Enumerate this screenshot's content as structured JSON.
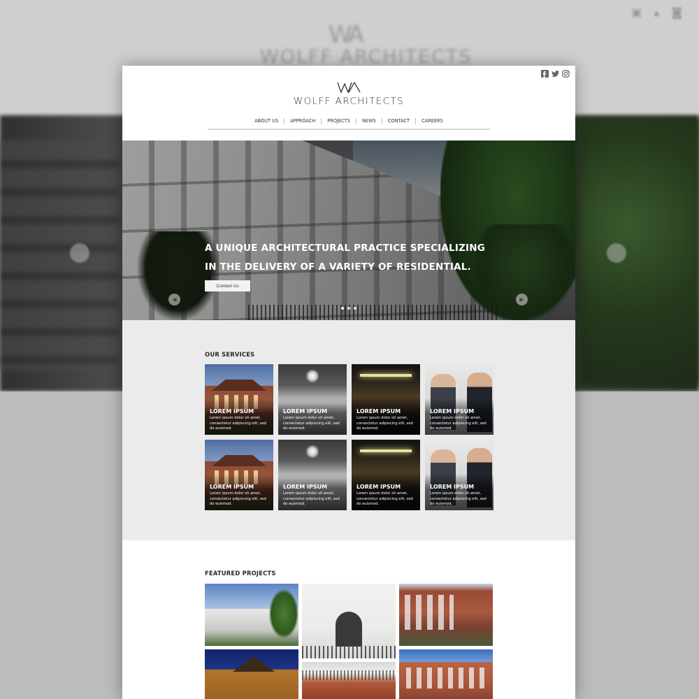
{
  "site": {
    "brand_mark": "WA",
    "brand_name": "WOLFF ARCHITECTS",
    "social": [
      {
        "icon": "facebook-icon"
      },
      {
        "icon": "twitter-icon"
      },
      {
        "icon": "instagram-icon"
      }
    ],
    "nav": [
      "ABOUT US",
      "APPROACH",
      "PROJECTS",
      "NEWS",
      "CONTACT",
      "CAREERS"
    ]
  },
  "hero": {
    "headline_line1": "A UNIQUE ARCHITECTURAL PRACTICE SPECIALIZING",
    "headline_line2": "IN THE DELIVERY OF A VARIETY OF RESIDENTIAL.",
    "cta_label": "Contact Us",
    "prev_icon": "chevron-left-icon",
    "next_icon": "chevron-right-icon",
    "slide_count": 3,
    "active_slide": 1
  },
  "services": {
    "title": "OUR SERVICES",
    "items": [
      {
        "title": "LOREM IPSUM",
        "desc": "Lorem ipsum dolor sit amet, consectetur adipiscing elit, sed do euismod."
      },
      {
        "title": "LOREM IPSUM",
        "desc": "Lorem ipsum dolor sit amet, consectetur adipiscing elit, sed do euismod."
      },
      {
        "title": "LOREM IPSUM",
        "desc": "Lorem ipsum dolor sit amet, consectetur adipiscing elit, sed do euismod."
      },
      {
        "title": "LOREM IPSUM",
        "desc": "Lorem ipsum dolor sit amet, consectetur adipiscing elit, sed do euismod."
      },
      {
        "title": "LOREM IPSUM",
        "desc": "Lorem ipsum dolor sit amet, consectetur adipiscing elit, sed do euismod."
      },
      {
        "title": "LOREM IPSUM",
        "desc": "Lorem ipsum dolor sit amet, consectetur adipiscing elit, sed do euismod."
      },
      {
        "title": "LOREM IPSUM",
        "desc": "Lorem ipsum dolor sit amet, consectetur adipiscing elit, sed do euismod."
      },
      {
        "title": "LOREM IPSUM",
        "desc": "Lorem ipsum dolor sit amet, consectetur adipiscing elit, sed do euismod."
      }
    ]
  },
  "featured": {
    "title": "FEATURED PROJECTS"
  },
  "colors": {
    "accent_text": "#333333",
    "services_bg": "#ebebeb",
    "backdrop": "#bdbdbd"
  }
}
